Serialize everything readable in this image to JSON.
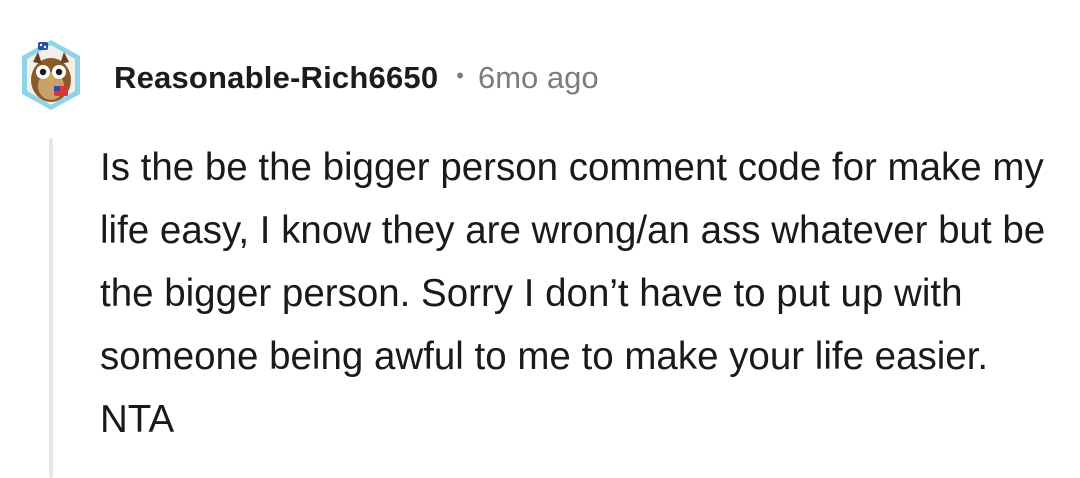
{
  "comment": {
    "author": "Reasonable-Rich6650",
    "separator": "•",
    "timestamp": "6mo ago",
    "avatar_icon": "owl-avatar-icon",
    "body": "Is the be the bigger person comment code for make my life easy, I know they are wrong/an ass whatever but be the bigger person. Sorry I don’t have to put up with someone being awful to me to make your life easier. NTA"
  },
  "colors": {
    "author": "#1c1c1c",
    "meta": "#7c7c7c",
    "body": "#1a1a1b",
    "thread_line": "#e4e6e8",
    "avatar_ring": "#8fd3e8"
  }
}
